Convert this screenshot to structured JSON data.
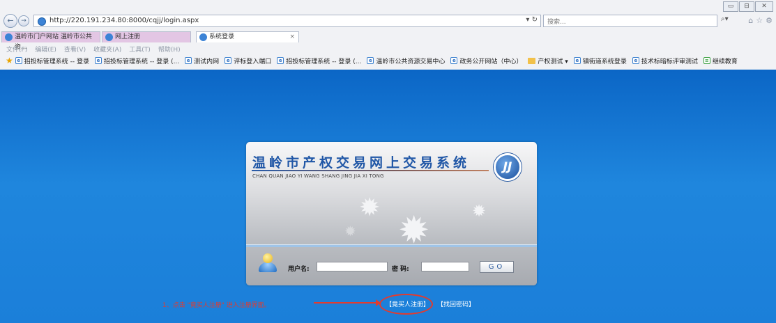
{
  "browser": {
    "window_controls": [
      "▭",
      "⊟",
      "✕"
    ],
    "address": "http://220.191.234.80:8000/cqjj/login.aspx",
    "search_placeholder": "搜索...",
    "tabs": [
      {
        "label": "温岭市门户网站 温岭市公共资..."
      },
      {
        "label": "网上注册"
      },
      {
        "label": "系统登录"
      }
    ],
    "menu": [
      "文件(F)",
      "编辑(E)",
      "查看(V)",
      "收藏夹(A)",
      "工具(T)",
      "帮助(H)"
    ],
    "favorites": [
      {
        "label": "招投标管理系统 -- 登录"
      },
      {
        "label": "招投标管理系统 -- 登录 (..."
      },
      {
        "label": "测试内网"
      },
      {
        "label": "评标登入端口"
      },
      {
        "label": "招投标管理系统 -- 登录 (..."
      },
      {
        "label": "温岭市公共资源交易中心"
      },
      {
        "label": "政务公开网站（中心）"
      },
      {
        "label": "产权测试 ▾",
        "folder": true
      },
      {
        "label": "镇街道系统登录"
      },
      {
        "label": "技术标暗标评审测试"
      },
      {
        "label": "继续教育"
      }
    ]
  },
  "login": {
    "title": "温岭市产权交易网上交易系统",
    "subtitle": "CHAN QUAN JIAO YI WANG SHANG JING JIA XI TONG",
    "logo_text": "JJ",
    "username_label": "用户名:",
    "password_label": "密 码:",
    "username_value": "",
    "password_value": "",
    "go_label": "GO"
  },
  "annotation": {
    "hint": "1、点击 \"竟买人注册\" 进入注册界面。",
    "register_link": "【竟买人注册】",
    "forgot_link": "【找回密码】"
  }
}
